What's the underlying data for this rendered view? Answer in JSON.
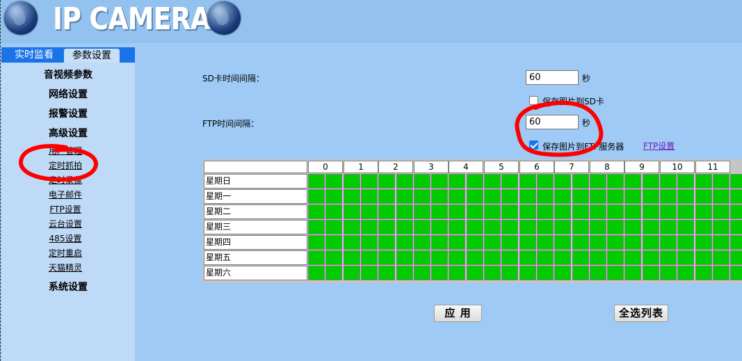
{
  "header": {
    "title": "IP CAMERA"
  },
  "tabs": [
    {
      "label": "实时监看"
    },
    {
      "label": "参数设置"
    }
  ],
  "sidebar": {
    "categories": [
      {
        "label": "音视频参数"
      },
      {
        "label": "网络设置"
      },
      {
        "label": "报警设置"
      },
      {
        "label": "高级设置"
      }
    ],
    "items": [
      {
        "label": "用户管理"
      },
      {
        "label": "定时抓拍"
      },
      {
        "label": "定时录像"
      },
      {
        "label": "电子邮件"
      },
      {
        "label": "FTP设置"
      },
      {
        "label": "云台设置"
      },
      {
        "label": "485设置"
      },
      {
        "label": "定时重启"
      },
      {
        "label": "天猫精灵"
      }
    ],
    "system": {
      "label": "系统设置"
    }
  },
  "form": {
    "sd_interval_label": "SD卡时间间隔：",
    "sd_interval_value": "60",
    "sd_unit": "秒",
    "save_sd_label": "保存图片到SD卡",
    "save_sd_checked": false,
    "ftp_interval_label": "FTP时间间隔：",
    "ftp_interval_value": "60",
    "ftp_unit": "秒",
    "save_ftp_label": "保存图片到FTP服务器",
    "save_ftp_checked": true,
    "ftp_settings_link": "FTP设置"
  },
  "schedule": {
    "hours": [
      "0",
      "1",
      "2",
      "3",
      "4",
      "5",
      "6",
      "7",
      "8",
      "9",
      "10",
      "11"
    ],
    "days": [
      "星期日",
      "星期一",
      "星期二",
      "星期三",
      "星期四",
      "星期五",
      "星期六"
    ],
    "cell_color": "#00cc00"
  },
  "buttons": {
    "apply": "应 用",
    "select_all": "全选列表"
  },
  "colors": {
    "accent": "#1a73e8",
    "annotation": "#ff0000"
  }
}
